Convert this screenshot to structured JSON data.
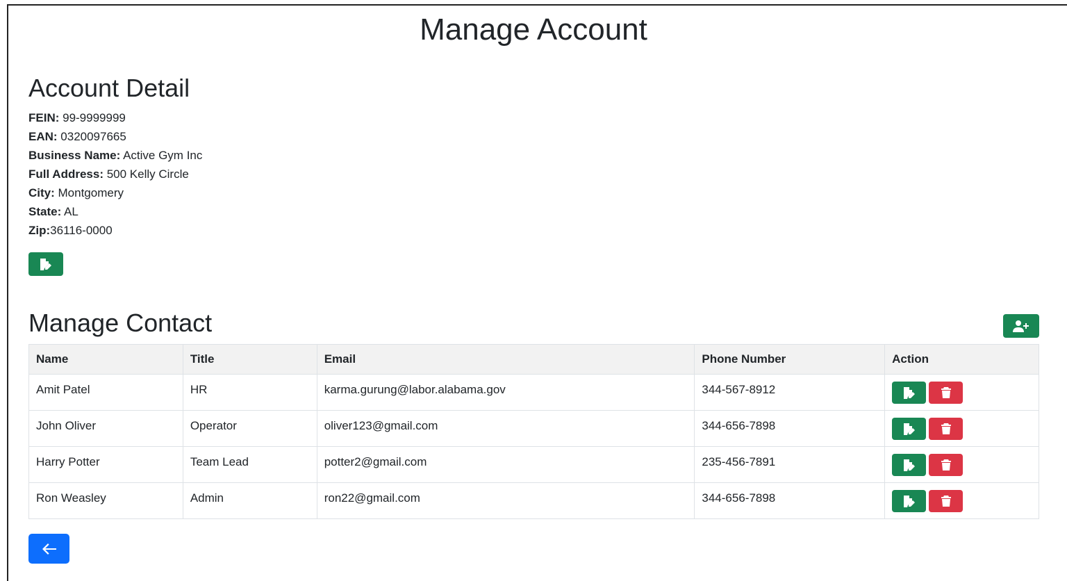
{
  "page": {
    "title": "Manage Account"
  },
  "account": {
    "heading": "Account Detail",
    "fields": [
      {
        "label": "FEIN:",
        "value": " 99-9999999"
      },
      {
        "label": "EAN:",
        "value": " 0320097665"
      },
      {
        "label": "Business Name:",
        "value": " Active Gym Inc"
      },
      {
        "label": "Full Address:",
        "value": " 500 Kelly Circle"
      },
      {
        "label": "City:",
        "value": " Montgomery"
      },
      {
        "label": "State:",
        "value": " AL"
      },
      {
        "label": "Zip:",
        "value": "36116-0000"
      }
    ]
  },
  "contacts": {
    "heading": "Manage Contact",
    "columns": [
      "Name",
      "Title",
      "Email",
      "Phone Number",
      "Action"
    ],
    "rows": [
      {
        "name": "Amit Patel",
        "title": "HR",
        "email": "karma.gurung@labor.alabama.gov",
        "phone": "344-567-8912"
      },
      {
        "name": "John Oliver",
        "title": "Operator",
        "email": "oliver123@gmail.com",
        "phone": "344-656-7898"
      },
      {
        "name": "Harry Potter",
        "title": "Team Lead",
        "email": "potter2@gmail.com",
        "phone": "235-456-7891"
      },
      {
        "name": "Ron Weasley",
        "title": "Admin",
        "email": "ron22@gmail.com",
        "phone": "344-656-7898"
      }
    ]
  },
  "icons": {
    "edit": "edit-icon",
    "delete": "trash-icon",
    "add_contact": "user-plus-icon",
    "back": "arrow-left-icon"
  },
  "colors": {
    "success": "#198754",
    "danger": "#dc3545",
    "primary": "#0d6efd"
  }
}
